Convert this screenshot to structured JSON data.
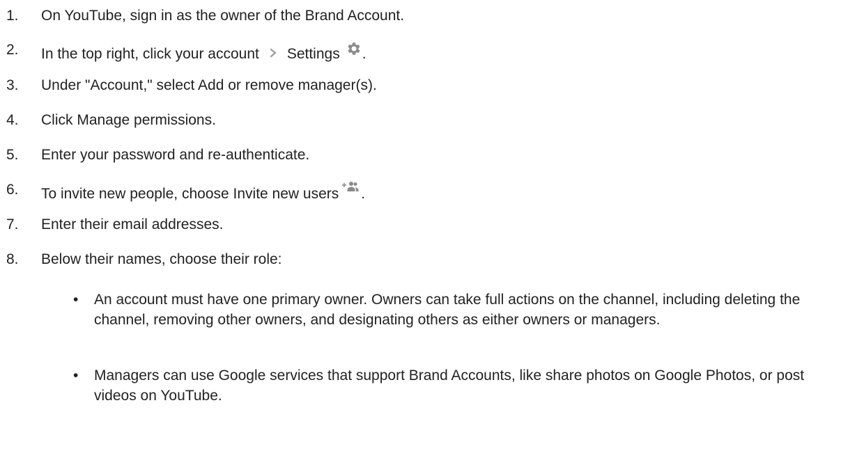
{
  "steps": [
    {
      "num": "1.",
      "text": "On YouTube, sign in as the owner of the Brand Account."
    },
    {
      "num": "2.",
      "pre": "In the top right, click your account",
      "mid": "Settings",
      "post": "."
    },
    {
      "num": "3.",
      "text": "Under \"Account,\" select Add or remove manager(s)."
    },
    {
      "num": "4.",
      "text": "Click Manage permissions."
    },
    {
      "num": "5.",
      "text": "Enter your password and re-authenticate."
    },
    {
      "num": "6.",
      "pre": "To invite new people, choose Invite new users",
      "post": "."
    },
    {
      "num": "7.",
      "text": "Enter their email addresses."
    },
    {
      "num": "8.",
      "text": "Below their names, choose their role:"
    }
  ],
  "roles": [
    {
      "bullet": "•",
      "text": "An account must have one primary owner. Owners can take full actions on the channel, including deleting the channel, removing other owners, and designating others as either owners or managers."
    },
    {
      "bullet": "•",
      "text": "Managers can use Google services that support Brand Accounts, like share photos on Google Photos, or post videos on YouTube."
    }
  ],
  "icons": {
    "chevron": "chevron-right-icon",
    "settings": "gear-icon",
    "invite": "add-people-icon",
    "icon_color": "#9e9e9e"
  }
}
